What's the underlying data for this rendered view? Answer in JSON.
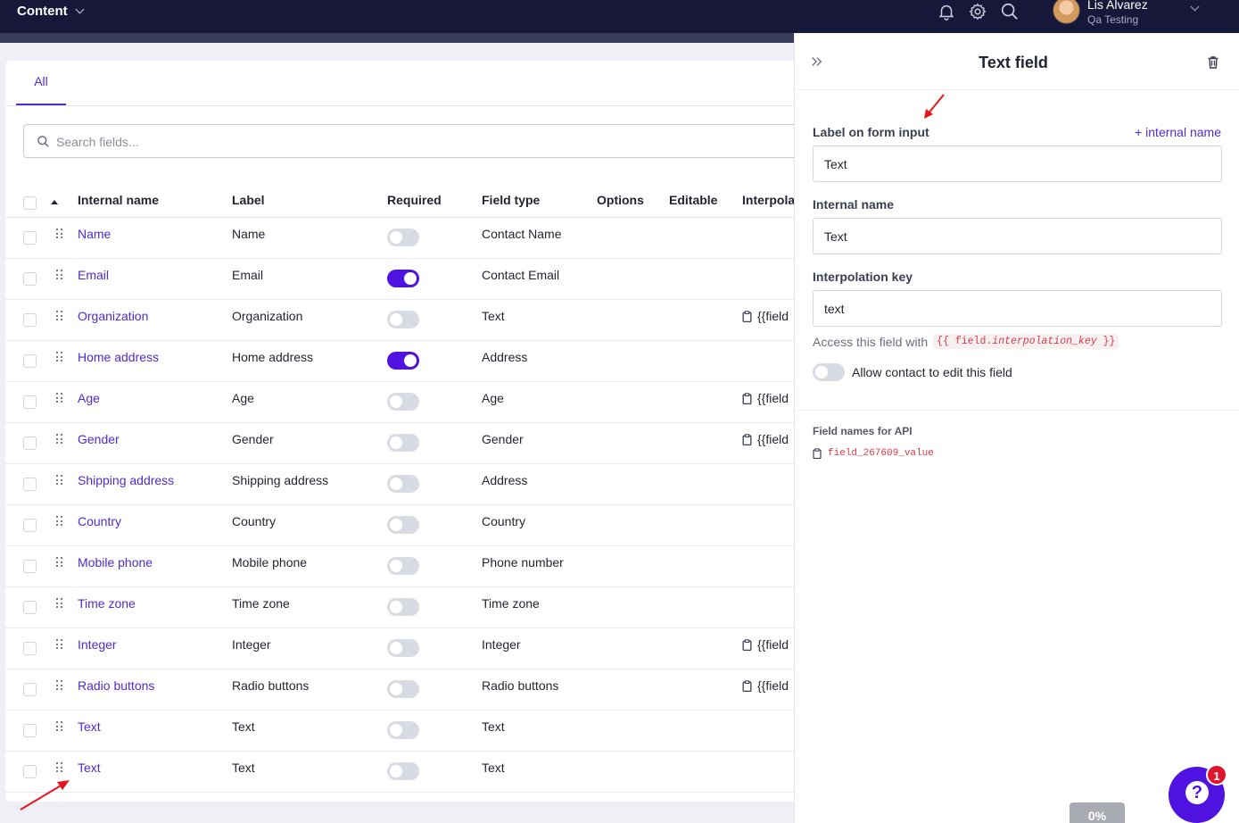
{
  "topbar": {
    "section_title": "Content",
    "user_name": "Lis Alvarez",
    "user_org": "Qa Testing",
    "icons": [
      "bell-icon",
      "gear-icon",
      "search-icon"
    ]
  },
  "tabs": [
    {
      "label": "All",
      "active": true
    }
  ],
  "search": {
    "placeholder": "Search fields...",
    "value": ""
  },
  "table": {
    "headers": {
      "internal_name": "Internal name",
      "label": "Label",
      "required": "Required",
      "field_type": "Field type",
      "options": "Options",
      "editable": "Editable",
      "interpolation": "Interpola"
    },
    "rows": [
      {
        "name": "Name",
        "label": "Name",
        "required": false,
        "type": "Contact Name",
        "interp": ""
      },
      {
        "name": "Email",
        "label": "Email",
        "required": true,
        "type": "Contact Email",
        "interp": ""
      },
      {
        "name": "Organization",
        "label": "Organization",
        "required": false,
        "type": "Text",
        "interp": "{{field"
      },
      {
        "name": "Home address",
        "label": "Home address",
        "required": true,
        "type": "Address",
        "interp": ""
      },
      {
        "name": "Age",
        "label": "Age",
        "required": false,
        "type": "Age",
        "interp": "{{field"
      },
      {
        "name": "Gender",
        "label": "Gender",
        "required": false,
        "type": "Gender",
        "interp": "{{field"
      },
      {
        "name": "Shipping address",
        "label": "Shipping address",
        "required": false,
        "type": "Address",
        "interp": ""
      },
      {
        "name": "Country",
        "label": "Country",
        "required": false,
        "type": "Country",
        "interp": ""
      },
      {
        "name": "Mobile phone",
        "label": "Mobile phone",
        "required": false,
        "type": "Phone number",
        "interp": ""
      },
      {
        "name": "Time zone",
        "label": "Time zone",
        "required": false,
        "type": "Time zone",
        "interp": ""
      },
      {
        "name": "Integer",
        "label": "Integer",
        "required": false,
        "type": "Integer",
        "interp": "{{field"
      },
      {
        "name": "Radio buttons",
        "label": "Radio buttons",
        "required": false,
        "type": "Radio buttons",
        "interp": "{{field"
      },
      {
        "name": "Text",
        "label": "Text",
        "required": false,
        "type": "Text",
        "interp": ""
      },
      {
        "name": "Text",
        "label": "Text",
        "required": false,
        "type": "Text",
        "interp": ""
      }
    ]
  },
  "panel": {
    "title": "Text field",
    "label_field": {
      "label": "Label on form input",
      "value": "Text",
      "link": "+ internal name"
    },
    "internal_name_field": {
      "label": "Internal name",
      "value": "Text"
    },
    "interpolation_field": {
      "label": "Interpolation key",
      "value": "text"
    },
    "access_text": "Access this field with",
    "access_code_open": "{{ field.",
    "access_code_key": "interpolation_key",
    "access_code_close": " }}",
    "allow_edit": {
      "label": "Allow contact to edit this field",
      "enabled": false
    },
    "api_title": "Field names for API",
    "api_field": "field_267609_value"
  },
  "help": {
    "badge": "1",
    "glyph": "?"
  },
  "progress": {
    "label": "0%",
    "value": 0
  },
  "colors": {
    "accent": "#4f12e0",
    "link": "#4f2bd1",
    "topbar": "#17173a",
    "badge": "#e0142c",
    "annotation_arrow": "#e8141c"
  }
}
